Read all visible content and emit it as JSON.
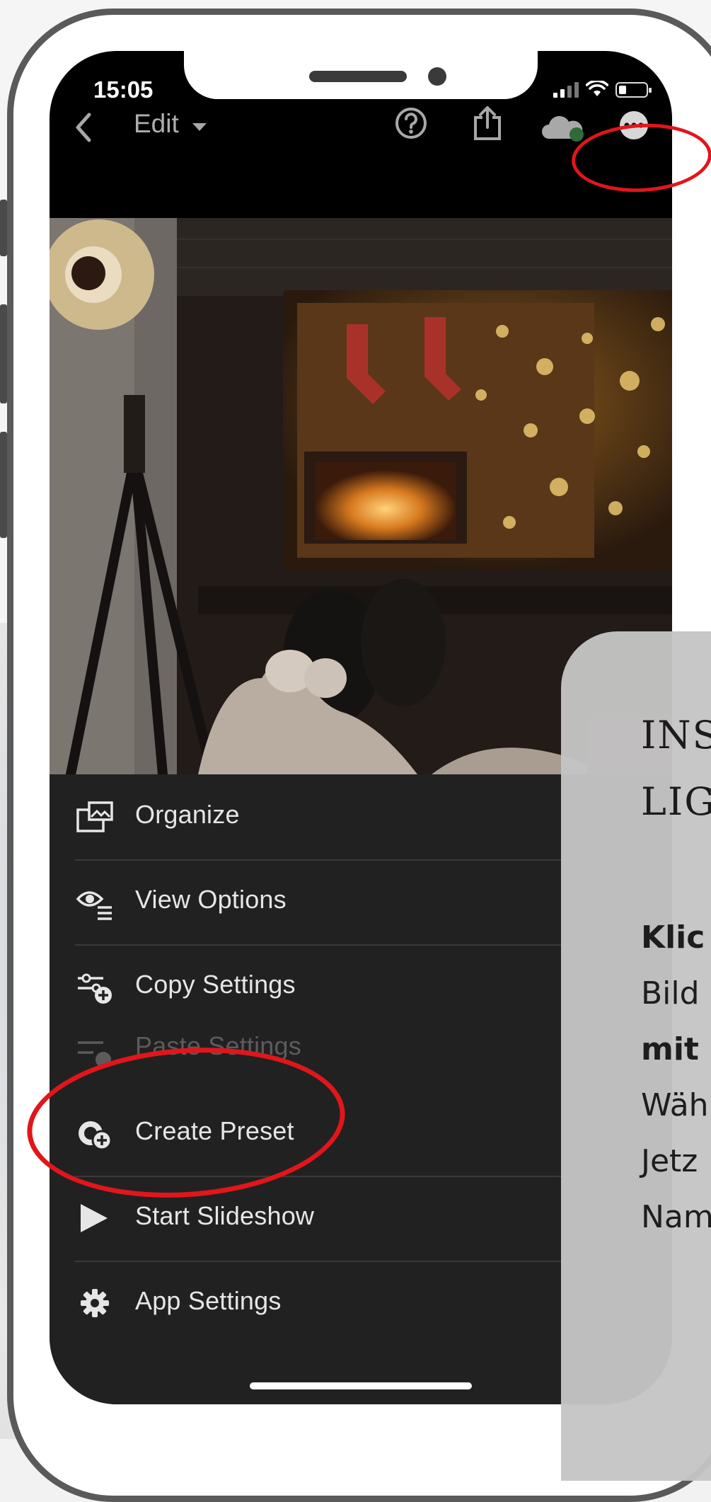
{
  "status": {
    "time": "15:05"
  },
  "toolbar": {
    "back_icon": "chevron-left-icon",
    "edit_label": "Edit",
    "dropdown_icon": "caret-down-icon",
    "actions": [
      "help-icon",
      "share-icon",
      "cloud-sync-icon",
      "more-icon"
    ]
  },
  "menu": {
    "items": [
      {
        "label": "Organize",
        "icon": "folder-photo-icon"
      },
      {
        "label": "View Options",
        "icon": "eye-list-icon"
      },
      {
        "label": "Copy Settings",
        "icon": "sliders-plus-icon"
      },
      {
        "label": "Paste Settings",
        "icon": "sliders-paste-icon",
        "disabled": true
      },
      {
        "label": "Create Preset",
        "icon": "preset-plus-icon"
      },
      {
        "label": "Start Slideshow",
        "icon": "play-icon"
      },
      {
        "label": "App Settings",
        "icon": "gear-icon"
      }
    ]
  },
  "card": {
    "title_lines": [
      "INS",
      "LIG"
    ],
    "body_lines": [
      {
        "text": "Klic",
        "bold": true
      },
      {
        "text": "Bild",
        "bold": false
      },
      {
        "text": "mit",
        "bold": true
      },
      {
        "text": "Wäh",
        "bold": false
      },
      {
        "text": "Jetz",
        "bold": false
      },
      {
        "text": "Nam",
        "bold": false
      }
    ]
  },
  "colors": {
    "annotation": "#e0161b",
    "menu_background": "#212121",
    "card_background": "#c5c5c5",
    "toolbar_background": "#000000"
  }
}
